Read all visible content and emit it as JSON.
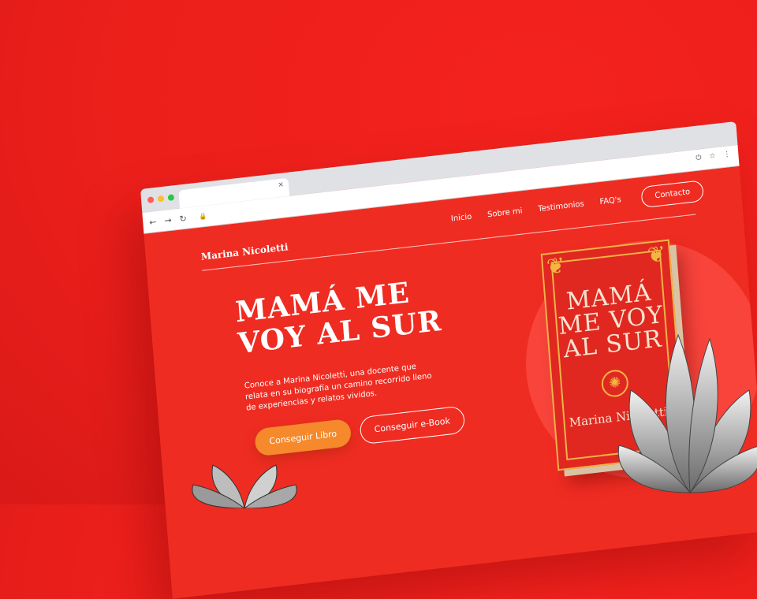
{
  "browser": {
    "tab_close": "×",
    "nav": {
      "back": "←",
      "forward": "→",
      "reload": "↻"
    },
    "lock": "🔒",
    "toolbar_icons": [
      "⏻",
      "☆",
      "⋮"
    ],
    "dot_colors": [
      "#ff5f57",
      "#febc2e",
      "#28c840"
    ]
  },
  "site": {
    "brand": "Marina Nicoletti",
    "menu": [
      "Inicio",
      "Sobre mi",
      "Testimonios",
      "FAQ's"
    ],
    "contact": "Contacto"
  },
  "hero": {
    "title_line1": "MAMÁ ME",
    "title_line2": "VOY AL SUR",
    "lead": "Conoce a Marina Nicoletti, una docente que relata en su biografía un camino recorrido lleno de experiencias y relatos vividos.",
    "cta_primary": "Conseguir Libro",
    "cta_secondary": "Conseguir e-Book"
  },
  "book": {
    "title_line1": "MAMÁ",
    "title_line2": "ME VOY",
    "title_line3": "AL SUR",
    "author": "Marina Nicoletti"
  },
  "colors": {
    "background": "#ec1f1b",
    "page": "#ef2c22",
    "accent_orange": "#f5892b",
    "book_gold": "#f0b247"
  }
}
